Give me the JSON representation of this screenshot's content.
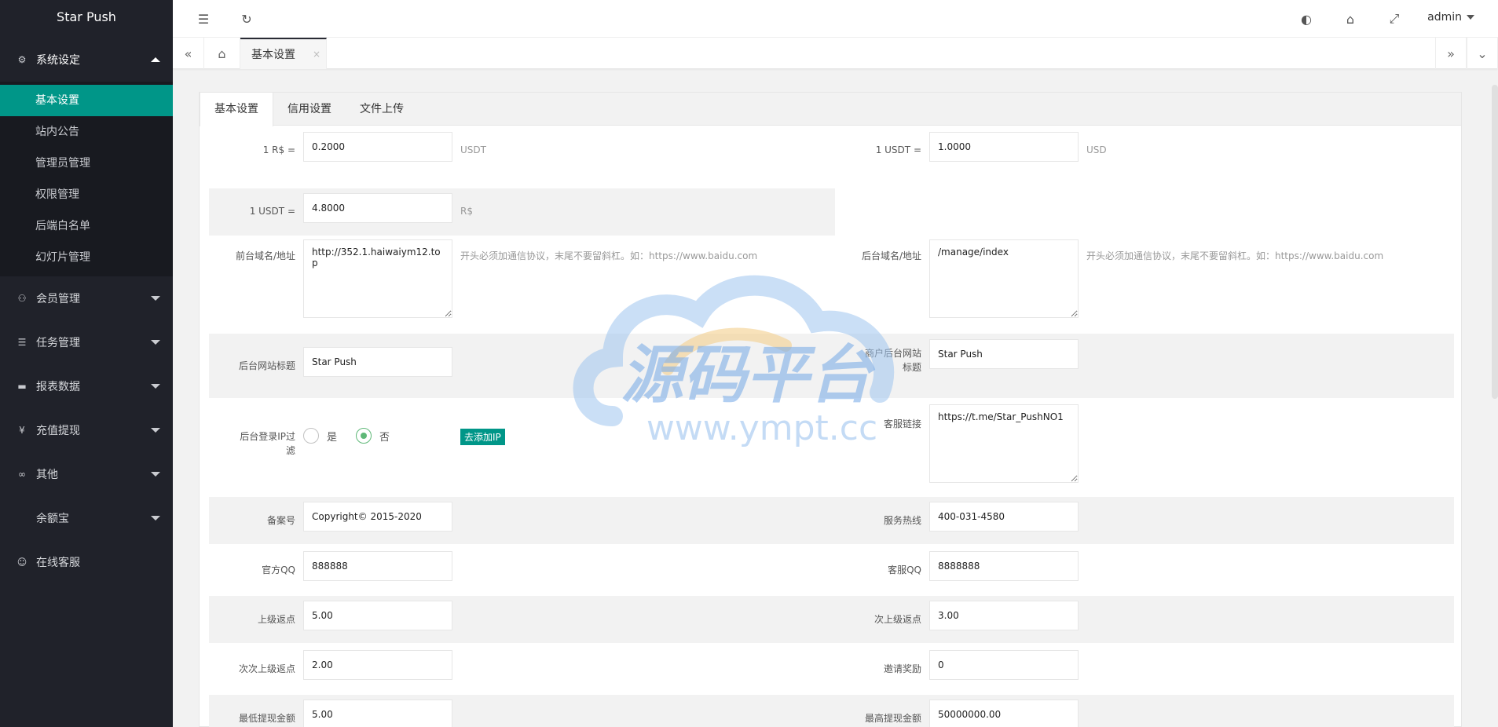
{
  "app": {
    "title": "Star Push"
  },
  "sidebar": {
    "groups": [
      {
        "label": "系统设定",
        "icon": "gear-icon",
        "open": true,
        "items": [
          {
            "label": "基本设置",
            "active": true
          },
          {
            "label": "站内公告"
          },
          {
            "label": "管理员管理"
          },
          {
            "label": "权限管理"
          },
          {
            "label": "后端白名单"
          },
          {
            "label": "幻灯片管理"
          }
        ]
      },
      {
        "label": "会员管理",
        "icon": "user-icon"
      },
      {
        "label": "任务管理",
        "icon": "task-icon"
      },
      {
        "label": "报表数据",
        "icon": "report-icon"
      },
      {
        "label": "充值提现",
        "icon": "yen-icon"
      },
      {
        "label": "其他",
        "icon": "link-icon"
      },
      {
        "label": "余额宝",
        "icon": ""
      },
      {
        "label": "在线客服",
        "icon": "service-icon"
      }
    ]
  },
  "header": {
    "user": "admin"
  },
  "tabsbar": {
    "current_tab": "基本设置",
    "close": "×"
  },
  "content_tabs": [
    "基本设置",
    "信用设置",
    "文件上传"
  ],
  "form": {
    "rate_rs_label": "1 R$ =",
    "rate_rs_value": "0.2000",
    "rate_rs_unit": "USDT",
    "rate_usd_label": "1 USDT =",
    "rate_usd_value": "1.0000",
    "rate_usd_unit": "USD",
    "rate_brl_label": "1 USDT =",
    "rate_brl_value": "4.8000",
    "rate_brl_unit": "R$",
    "front_domain_label": "前台域名/地址",
    "front_domain_value": "http://352.1.haiwaiym12.top",
    "front_domain_hint": "开头必须加通信协议，末尾不要留斜杠。如：https://www.baidu.com",
    "back_domain_label": "后台域名/地址",
    "back_domain_value": "/manage/index",
    "back_domain_hint": "开头必须加通信协议，末尾不要留斜杠。如：https://www.baidu.com",
    "admin_title_label": "后台网站标题",
    "admin_title_value": "Star Push",
    "merchant_title_label_1": "商户后台网站",
    "merchant_title_label_2": "标题",
    "merchant_title_value": "Star Push",
    "ip_filter_label_1": "后台登录IP过",
    "ip_filter_label_2": "滤",
    "ip_filter_yes": "是",
    "ip_filter_no": "否",
    "ip_filter_selected": "否",
    "add_ip_button": "去添加IP",
    "service_link_label": "客服链接",
    "service_link_value": "https://t.me/Star_PushNO1",
    "icp_label": "备案号",
    "icp_value": "Copyright© 2015-2020",
    "hotline_label": "服务热线",
    "hotline_value": "400-031-4580",
    "official_qq_label": "官方QQ",
    "official_qq_value": "888888",
    "service_qq_label": "客服QQ",
    "service_qq_value": "8888888",
    "rebate1_label": "上级返点",
    "rebate1_value": "5.00",
    "rebate2_label": "次上级返点",
    "rebate2_value": "3.00",
    "rebate3_label": "次次上级返点",
    "rebate3_value": "2.00",
    "invite_label": "邀请奖励",
    "invite_value": "0",
    "min_withdraw_label": "最低提现金额",
    "min_withdraw_value": "5.00",
    "max_withdraw_label": "最高提现金额",
    "max_withdraw_value": "50000000.00"
  },
  "watermark": {
    "title": "源码平台",
    "url": "www.ympt.cc"
  },
  "colors": {
    "sidebar_bg": "#20222a",
    "accent": "#009688",
    "radio_on": "#5FB878"
  }
}
